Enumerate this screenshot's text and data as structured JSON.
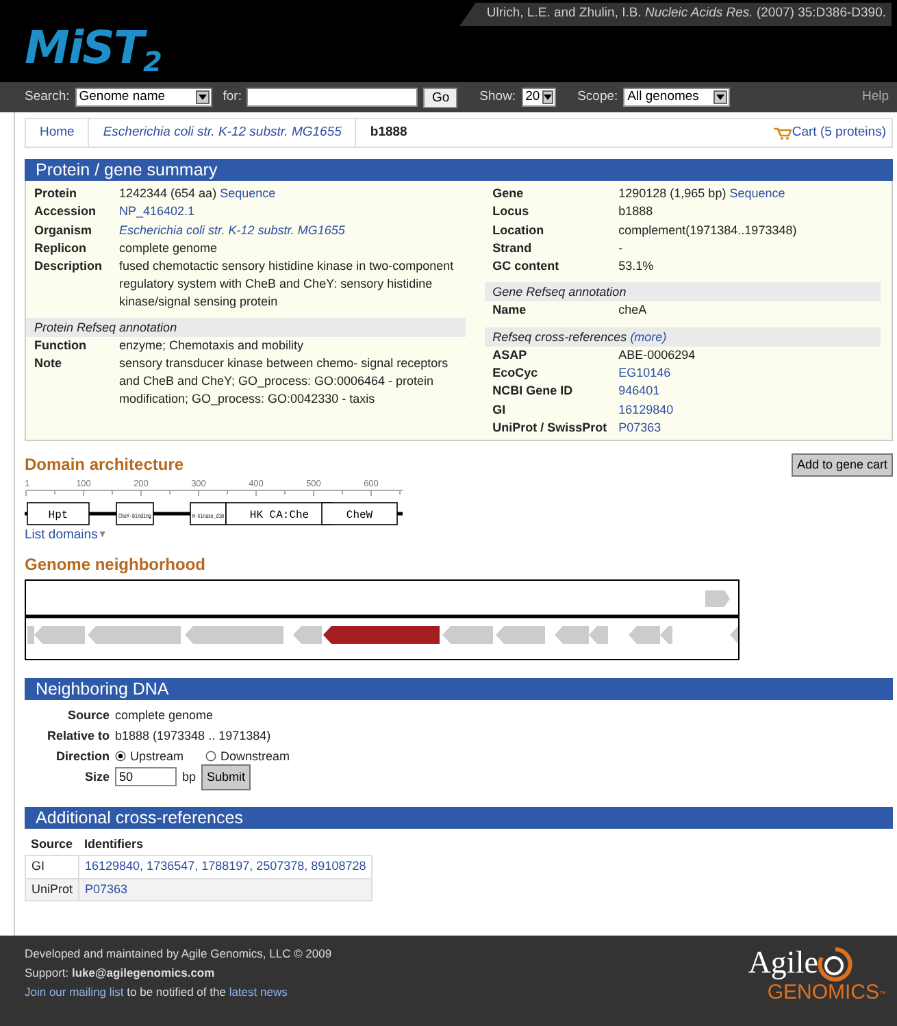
{
  "header": {
    "logo": "MiST",
    "logo_sub": "2",
    "citation": "Ulrich, L.E. and Zhulin, I.B. *Nucleic Acids Res.* (2007) 35:D386-D390."
  },
  "search_bar": {
    "search_label": "Search:",
    "search_by": "Genome name",
    "for_label": "for:",
    "go": "Go",
    "show_label": "Show:",
    "show": "20",
    "scope_label": "Scope:",
    "scope": "All genomes",
    "help": "Help"
  },
  "breadcrumb": [
    {
      "label": "Home",
      "kind": "link"
    },
    {
      "label": "Escherichia coli str. K-12 substr. MG1655",
      "kind": "italic-link"
    },
    {
      "label": "b1888",
      "kind": "current"
    }
  ],
  "cart": "Cart (5 proteins)",
  "summary": {
    "title": "Protein / gene summary",
    "left": [
      {
        "rows": [
          {
            "label": "Protein",
            "parts": [
              {
                "text": "1242344 (654 aa) ",
                "kind": "plain"
              },
              {
                "text": "Sequence",
                "kind": "link"
              }
            ]
          },
          {
            "label": "Accession",
            "parts": [
              {
                "text": "NP_416402.1",
                "kind": "link"
              }
            ]
          },
          {
            "label": "Organism",
            "parts": [
              {
                "text": "Escherichia coli str. K-12 substr. MG1655",
                "kind": "italic-link"
              }
            ]
          },
          {
            "label": "Replicon",
            "parts": [
              {
                "text": "complete genome",
                "kind": "plain"
              }
            ]
          },
          {
            "label": "Description",
            "parts": [
              {
                "text": "fused chemotactic sensory histidine kinase in two-component regulatory system with CheB and CheY: sensory histidine kinase/signal sensing protein",
                "kind": "plain"
              }
            ]
          }
        ]
      },
      {
        "heading": "Protein Refseq annotation",
        "rows": [
          {
            "label": "Function",
            "parts": [
              {
                "text": "enzyme; Chemotaxis and mobility",
                "kind": "plain"
              }
            ]
          },
          {
            "label": "Note",
            "parts": [
              {
                "text": "sensory transducer kinase between chemo- signal receptors and CheB and CheY; GO_process: GO:0006464 - protein modification; GO_process: GO:0042330 - taxis",
                "kind": "plain"
              }
            ]
          }
        ]
      }
    ],
    "right": [
      {
        "rows": [
          {
            "label": "Gene",
            "parts": [
              {
                "text": "1290128 (1,965 bp) ",
                "kind": "plain"
              },
              {
                "text": "Sequence",
                "kind": "link"
              }
            ]
          },
          {
            "label": "Locus",
            "parts": [
              {
                "text": "b1888",
                "kind": "plain"
              }
            ]
          },
          {
            "label": "Location",
            "parts": [
              {
                "text": "complement(1971384..1973348)",
                "kind": "plain"
              }
            ]
          },
          {
            "label": "Strand",
            "parts": [
              {
                "text": "-",
                "kind": "plain"
              }
            ]
          },
          {
            "label": "GC content",
            "parts": [
              {
                "text": "53.1%",
                "kind": "plain"
              }
            ]
          }
        ]
      },
      {
        "heading": "Gene Refseq annotation",
        "rows": [
          {
            "label": "Name",
            "parts": [
              {
                "text": "cheA",
                "kind": "plain"
              }
            ]
          }
        ]
      },
      {
        "heading": "Refseq cross-references",
        "heading_link": "(more)",
        "rows": [
          {
            "label": "ASAP",
            "parts": [
              {
                "text": "ABE-0006294",
                "kind": "plain"
              }
            ]
          },
          {
            "label": "EcoCyc",
            "parts": [
              {
                "text": "EG10146",
                "kind": "link"
              }
            ]
          },
          {
            "label": "NCBI Gene ID",
            "parts": [
              {
                "text": "946401",
                "kind": "link"
              }
            ]
          },
          {
            "label": "GI",
            "parts": [
              {
                "text": "16129840",
                "kind": "link"
              }
            ]
          },
          {
            "label": "UniProt / SwissProt",
            "parts": [
              {
                "text": "P07363",
                "kind": "link"
              }
            ]
          }
        ]
      }
    ]
  },
  "domain_architecture": {
    "title": "Domain architecture",
    "add_button": "Add to gene cart",
    "ruler": [
      "1",
      "100",
      "200",
      "300",
      "400",
      "500",
      "600"
    ],
    "domains": [
      {
        "label": "Hpt"
      },
      {
        "label": "CheY-binding"
      },
      {
        "label": "H-kinase_dim"
      },
      {
        "label": "HK CA:Che"
      },
      {
        "label": "CheW"
      }
    ],
    "list_domains": "List domains",
    "list_caret": "▼"
  },
  "genome_neighborhood": {
    "title": "Genome neighborhood"
  },
  "neighboring_dna": {
    "title": "Neighboring DNA",
    "source_label": "Source",
    "source": "complete genome",
    "relative_label": "Relative to",
    "relative": "b1888 (1973348 .. 1971384)",
    "direction_label": "Direction",
    "directions": [
      {
        "label": "Upstream",
        "selected": true
      },
      {
        "label": "Downstream",
        "selected": false
      }
    ],
    "size_label": "Size",
    "size": "50",
    "unit": "bp",
    "submit": "Submit"
  },
  "cross_references": {
    "title": "Additional cross-references",
    "columns": [
      "Source",
      "Identifiers"
    ],
    "rows": [
      {
        "source": "GI",
        "ids": "16129840, 1736547, 1788197, 2507378, 89108728"
      },
      {
        "source": "UniProt",
        "ids": "P07363"
      }
    ]
  },
  "footer": {
    "developed": "Developed and maintained by Agile Genomics, LLC © 2009",
    "support": "Support: **luke@agilegenomics.com**",
    "mailing": [
      {
        "text": "Join our mailing list",
        "kind": "link"
      },
      {
        "text": " to be notified of the ",
        "kind": "plain"
      },
      {
        "text": "latest news",
        "kind": "link"
      }
    ],
    "logo": "Agile",
    "logo_sub": "GENOMICS",
    "logo_tm": "™"
  }
}
